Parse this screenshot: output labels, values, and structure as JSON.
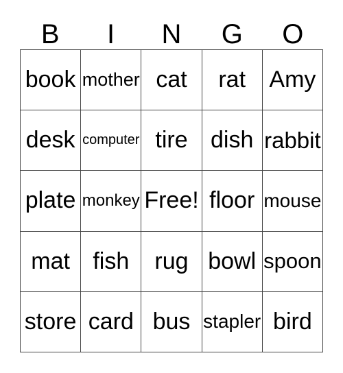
{
  "header": [
    "B",
    "I",
    "N",
    "G",
    "O"
  ],
  "cells": [
    [
      "book",
      "mother",
      "cat",
      "rat",
      "Amy"
    ],
    [
      "desk",
      "computer",
      "tire",
      "dish",
      "rabbit"
    ],
    [
      "plate",
      "monkey",
      "Free!",
      "floor",
      "mouse"
    ],
    [
      "mat",
      "fish",
      "rug",
      "bowl",
      "spoon"
    ],
    [
      "store",
      "card",
      "bus",
      "stapler",
      "bird"
    ]
  ]
}
